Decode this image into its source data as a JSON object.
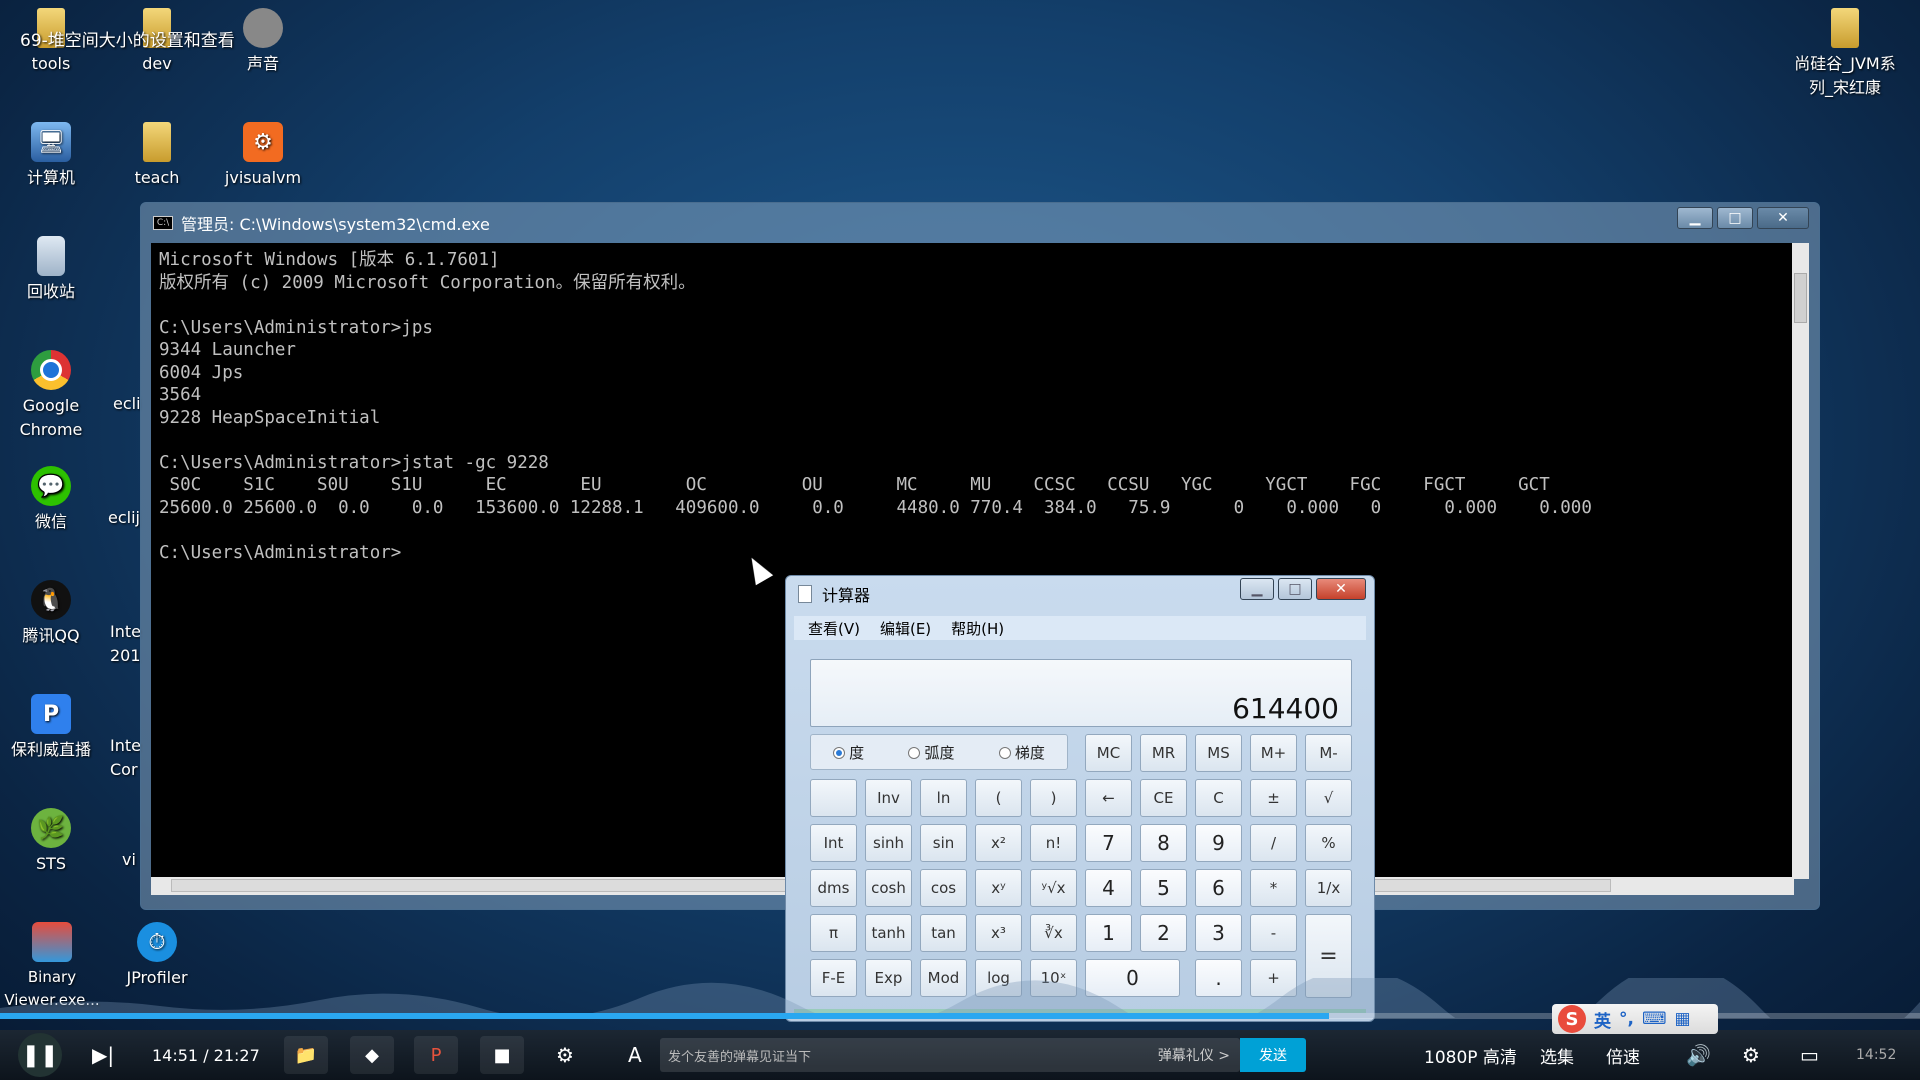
{
  "video_title": "69-堆空间大小的设置和查看",
  "desktop_icons": [
    {
      "label": "tools",
      "icon": "folder-icon"
    },
    {
      "label": "dev",
      "icon": "folder-icon"
    },
    {
      "label": "声音",
      "icon": "audio-icon"
    },
    {
      "label": "计算机",
      "icon": "computer-icon"
    },
    {
      "label": "teach",
      "icon": "folder-icon"
    },
    {
      "label": "jvisualvm",
      "icon": "jvisualvm-icon"
    },
    {
      "label": "回收站",
      "icon": "recycle-bin-icon"
    },
    {
      "label": "Google Chrome",
      "icon": "chrome-icon"
    },
    {
      "label": "微信",
      "icon": "wechat-icon"
    },
    {
      "label": "腾讯QQ",
      "icon": "qq-icon"
    },
    {
      "label": "保利威直播",
      "icon": "polyv-icon"
    },
    {
      "label": "STS",
      "icon": "sts-icon"
    },
    {
      "label": "Binary Viewer.exe...",
      "icon": "binary-viewer-icon"
    },
    {
      "label": "JProfiler",
      "icon": "jprofiler-icon"
    },
    {
      "label": "尚硅谷_JVM系列_宋红康",
      "icon": "folder-icon"
    }
  ],
  "partial_labels": [
    "ecli",
    "eclij",
    "Inte",
    "201",
    "Inte",
    "Cor",
    "vi"
  ],
  "cmd": {
    "title": "管理员: C:\\Windows\\system32\\cmd.exe",
    "lines": [
      "Microsoft Windows [版本 6.1.7601]",
      "版权所有 (c) 2009 Microsoft Corporation。保留所有权利。",
      "",
      "C:\\Users\\Administrator>jps",
      "9344 Launcher",
      "6004 Jps",
      "3564",
      "9228 HeapSpaceInitial",
      "",
      "C:\\Users\\Administrator>jstat -gc 9228",
      " S0C    S1C    S0U    S1U      EC       EU        OC         OU       MC     MU    CCSC   CCSU   YGC     YGCT    FGC    FGCT     GCT",
      "25600.0 25600.0  0.0    0.0   153600.0 12288.1   409600.0     0.0     4480.0 770.4  384.0   75.9      0    0.000   0      0.000    0.000",
      "",
      "C:\\Users\\Administrator>"
    ]
  },
  "calculator": {
    "title": "计算器",
    "menu": [
      "查看(V)",
      "编辑(E)",
      "帮助(H)"
    ],
    "display": "614400",
    "modes": [
      {
        "label": "度",
        "selected": true
      },
      {
        "label": "弧度",
        "selected": false
      },
      {
        "label": "梯度",
        "selected": false
      }
    ],
    "memory_buttons": [
      "MC",
      "MR",
      "MS",
      "M+",
      "M-"
    ],
    "rows": [
      [
        "",
        "Inv",
        "ln",
        "(",
        ")",
        "←",
        "CE",
        "C",
        "±",
        "√"
      ],
      [
        "Int",
        "sinh",
        "sin",
        "x²",
        "n!",
        "7",
        "8",
        "9",
        "/",
        "%"
      ],
      [
        "dms",
        "cosh",
        "cos",
        "xʸ",
        "ʸ√x",
        "4",
        "5",
        "6",
        "*",
        "1/x"
      ],
      [
        "π",
        "tanh",
        "tan",
        "x³",
        "∛x",
        "1",
        "2",
        "3",
        "-",
        "="
      ],
      [
        "F-E",
        "Exp",
        "Mod",
        "log",
        "10ˣ",
        "0",
        ".",
        "+"
      ]
    ]
  },
  "player": {
    "time_current": "14:51",
    "time_total": "21:27",
    "progress_fraction": 0.692,
    "danmu_placeholder": "发个友善的弹幕见证当下",
    "danmu_etiquette": "弹幕礼仪 >",
    "send_label": "发送",
    "quality_label": "1080P 高清",
    "episodes_label": "选集",
    "speed_label": "倍速",
    "clock": "14:52"
  },
  "ime": {
    "lang": "英"
  },
  "colors": {
    "accent": "#00a1d6",
    "progress": "#2aa7f0",
    "console_bg": "#000000",
    "console_text": "#c0c0c0"
  }
}
